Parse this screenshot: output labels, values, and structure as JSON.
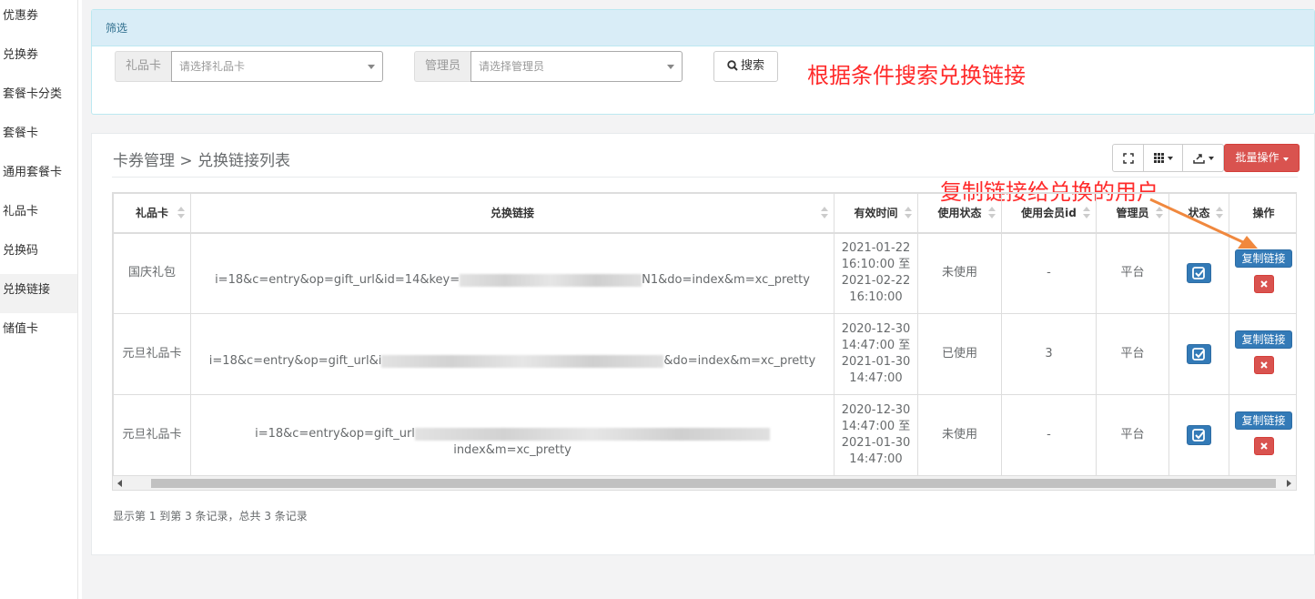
{
  "sidebar": {
    "items": [
      {
        "label": "优惠券"
      },
      {
        "label": "兑换券"
      },
      {
        "label": "套餐卡分类"
      },
      {
        "label": "套餐卡"
      },
      {
        "label": "通用套餐卡"
      },
      {
        "label": "礼品卡"
      },
      {
        "label": "兑换码"
      },
      {
        "label": "兑换链接",
        "active": true
      },
      {
        "label": "储值卡"
      }
    ]
  },
  "filter": {
    "title": "筛选",
    "gift_card_label": "礼品卡",
    "gift_card_placeholder": "请选择礼品卡",
    "admin_label": "管理员",
    "admin_placeholder": "请选择管理员",
    "search_label": "搜索"
  },
  "annotations": {
    "search_note": "根据条件搜索兑换链接",
    "copy_note": "复制链接给兑换的用户",
    "arrow_color": "#f0883e"
  },
  "list": {
    "breadcrumb": "卡券管理 > 兑换链接列表",
    "batch_label": "批量操作",
    "columns": [
      "礼品卡",
      "兑换链接",
      "有效时间",
      "使用状态",
      "使用会员id",
      "管理员",
      "状态",
      "操作"
    ],
    "rows": [
      {
        "gift_card": "国庆礼包",
        "link_head": "i=18&c=entry&op=gift_url&id=14&key=",
        "link_tail": "N1&do=index&m=xc_pretty",
        "valid_from": "2021-01-22 16:10:00 至",
        "valid_to": "2021-02-22 16:10:00",
        "use_status": "未使用",
        "member_id": "-",
        "admin": "平台",
        "copy_label": "复制链接"
      },
      {
        "gift_card": "元旦礼品卡",
        "link_head": "i=18&c=entry&op=gift_url&i",
        "link_tail": "&do=index&m=xc_pretty",
        "valid_from": "2020-12-30 14:47:00 至",
        "valid_to": "2021-01-30 14:47:00",
        "use_status": "已使用",
        "member_id": "3",
        "admin": "平台",
        "copy_label": "复制链接"
      },
      {
        "gift_card": "元旦礼品卡",
        "link_head": "i=18&c=entry&op=gift_url",
        "link_tail": "index&m=xc_pretty",
        "valid_from": "2020-12-30 14:47:00 至",
        "valid_to": "2021-01-30 14:47:00",
        "use_status": "未使用",
        "member_id": "-",
        "admin": "平台",
        "copy_label": "复制链接"
      }
    ],
    "pager_info": "显示第 1 到第 3 条记录，总共 3 条记录"
  },
  "colors": {
    "primary": "#337ab7",
    "danger": "#d9534f",
    "filter_head_bg": "#d9edf7",
    "annotation_red": "#ff2a2a"
  }
}
